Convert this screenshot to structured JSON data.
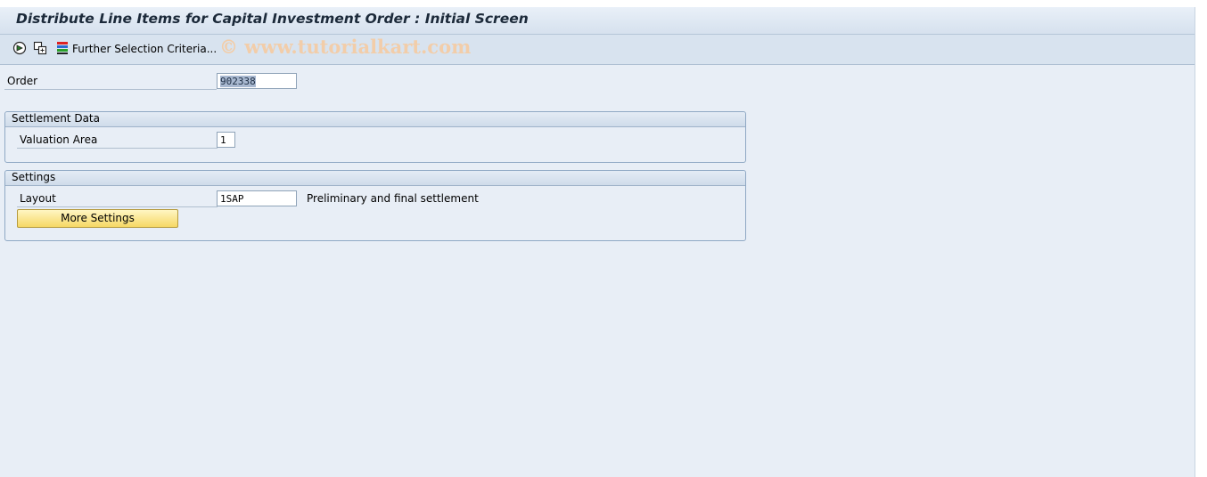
{
  "title": "Distribute Line Items for Capital Investment Order : Initial Screen",
  "toolbar": {
    "execute_icon": "execute-icon",
    "copy_icon": "multiple-selection-icon",
    "further_selection_icon": "selection-criteria-icon",
    "further_selection_label": "Further Selection Criteria...",
    "watermark": "© www.tutorialkart.com"
  },
  "order": {
    "label": "Order",
    "value": "902338"
  },
  "settlement": {
    "title": "Settlement Data",
    "valuation_area_label": "Valuation Area",
    "valuation_area_value": "1"
  },
  "settings": {
    "title": "Settings",
    "layout_label": "Layout",
    "layout_value": "1SAP",
    "layout_description": "Preliminary and final settlement",
    "more_settings_label": "More Settings"
  },
  "colors": {
    "background": "#e8eef6",
    "button": "#f6d865",
    "watermark": "#f2cda9"
  }
}
